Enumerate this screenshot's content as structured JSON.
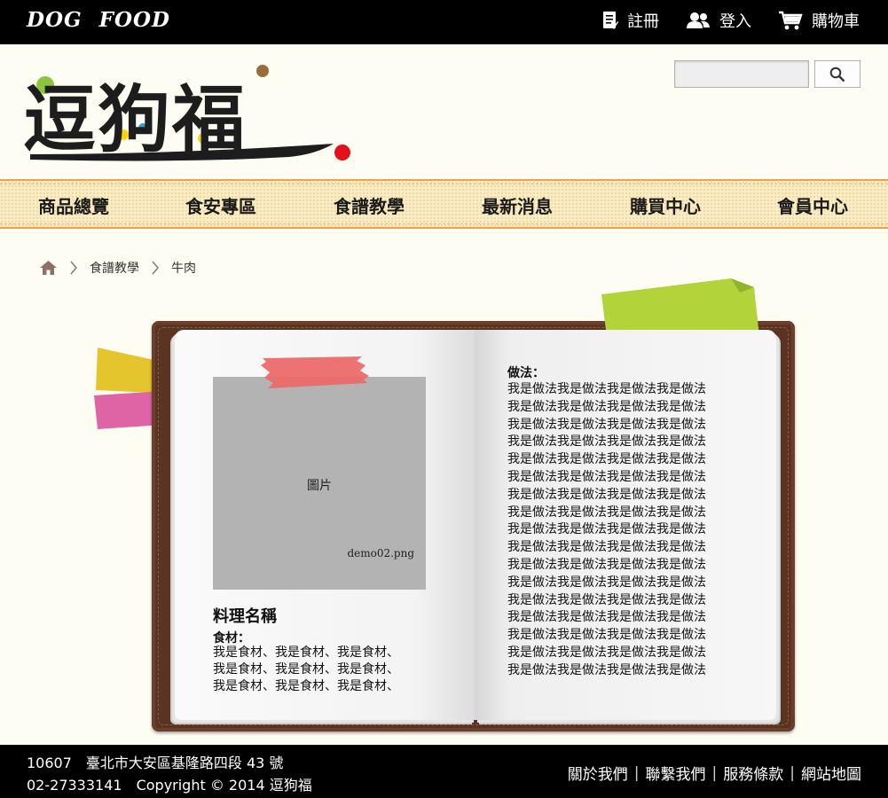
{
  "header": {
    "brand": "DOG FOOD",
    "links": {
      "register": "註冊",
      "login": "登入",
      "cart": "購物車"
    },
    "logo_text": "逗狗福",
    "search_placeholder": ""
  },
  "nav": {
    "items": [
      "商品總覽",
      "食安專區",
      "食譜教學",
      "最新消息",
      "購買中心",
      "會員中心"
    ]
  },
  "breadcrumb": {
    "items": [
      "食譜教學",
      "牛肉"
    ]
  },
  "book": {
    "left": {
      "image_label": "圖片",
      "image_file": "demo02.png",
      "recipe_title": "料理名稱",
      "ingredients_label": "食材：",
      "ingredients": [
        "我是食材、我是食材、我是食材、",
        "我是食材、我是食材、我是食材、",
        "我是食材、我是食材、我是食材、"
      ]
    },
    "right": {
      "method_label": "做法：",
      "method_lines": [
        "我是做法我是做法我是做法我是做法",
        "我是做法我是做法我是做法我是做法",
        "我是做法我是做法我是做法我是做法",
        "我是做法我是做法我是做法我是做法",
        "我是做法我是做法我是做法我是做法",
        "我是做法我是做法我是做法我是做法",
        "我是做法我是做法我是做法我是做法",
        "我是做法我是做法我是做法我是做法",
        "我是做法我是做法我是做法我是做法",
        "我是做法我是做法我是做法我是做法",
        "我是做法我是做法我是做法我是做法",
        "我是做法我是做法我是做法我是做法",
        "我是做法我是做法我是做法我是做法",
        "我是做法我是做法我是做法我是做法",
        "我是做法我是做法我是做法我是做法",
        "我是做法我是做法我是做法我是做法",
        "我是做法我是做法我是做法我是做法"
      ]
    }
  },
  "footer": {
    "address_line": "10607　臺北市大安區基隆路四段 43 號",
    "copyright_line": "02-27333141　Copyright © 2014 逗狗福",
    "links": [
      "關於我們",
      "聯繫我們",
      "服務條款",
      "網站地圖"
    ]
  },
  "colors": {
    "topbar": "#000000",
    "page_bg": "#fdfdf3",
    "nav_bg": "#faecc4",
    "nav_border": "#f2a04a",
    "book_cover": "#5b3322",
    "tape_green": "#b2d43a",
    "tab_yellow": "#e4c52e",
    "tab_pink": "#de64a6",
    "tape_red": "#ec6a6a"
  }
}
